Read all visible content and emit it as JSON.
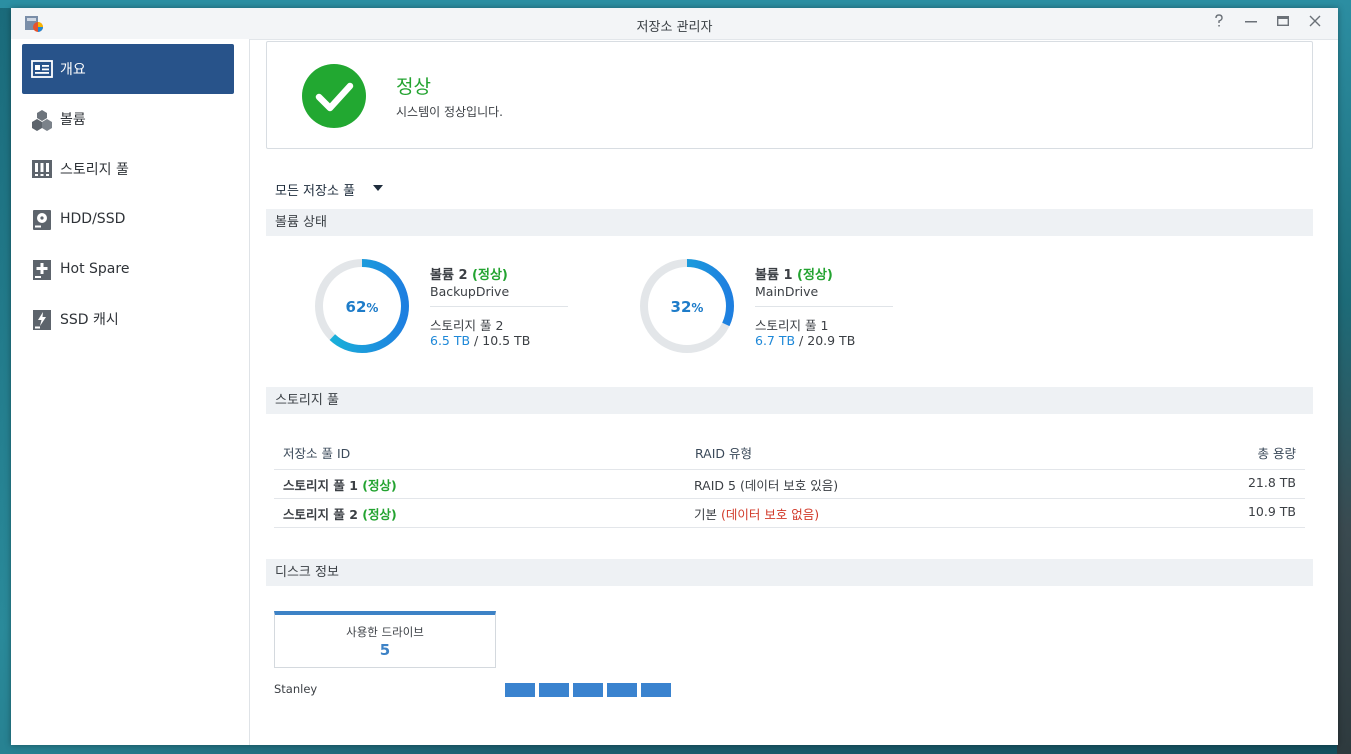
{
  "window": {
    "title": "저장소 관리자",
    "help_icon": "help-icon",
    "minimize_icon": "minimize-icon",
    "maximize_icon": "maximize-icon",
    "close_icon": "close-icon"
  },
  "sidebar": {
    "items": [
      {
        "label": "개요",
        "icon": "overview-icon",
        "active": true
      },
      {
        "label": "볼륨",
        "icon": "volume-cubes-icon",
        "active": false
      },
      {
        "label": "스토리지 풀",
        "icon": "storage-pool-icon",
        "active": false
      },
      {
        "label": "HDD/SSD",
        "icon": "disk-icon",
        "active": false
      },
      {
        "label": "Hot Spare",
        "icon": "hot-spare-plus-icon",
        "active": false
      },
      {
        "label": "SSD 캐시",
        "icon": "ssd-cache-bolt-icon",
        "active": false
      }
    ]
  },
  "status": {
    "title": "정상",
    "subtitle": "시스템이 정상입니다.",
    "color": "#22a831"
  },
  "pool_filter": {
    "label": "모든 저장소 풀"
  },
  "volume_section": {
    "title": "볼륨 상태"
  },
  "volumes": [
    {
      "percent": 62,
      "percent_label": "62",
      "pct_sign": "%",
      "name": "볼륨 2 ",
      "state": "정상",
      "desc": "BackupDrive",
      "pool": "스토리지 풀 2",
      "used": "6.5 TB",
      "sep": " / ",
      "total": "10.5 TB"
    },
    {
      "percent": 32,
      "percent_label": "32",
      "pct_sign": "%",
      "name": "볼륨 1 ",
      "state": "정상",
      "desc": "MainDrive",
      "pool": "스토리지 풀 1",
      "used": "6.7 TB",
      "sep": " / ",
      "total": "20.9 TB"
    }
  ],
  "pool_section": {
    "title": "스토리지 풀"
  },
  "pool_table": {
    "headers": [
      "저장소 풀 ID",
      "RAID 유형",
      "총 용량"
    ],
    "rows": [
      {
        "id": "스토리지 풀 1 ",
        "state": "정상",
        "raid": "RAID 5 (데이터 보호 있음)",
        "raid_type": "",
        "raid_note": "",
        "capacity": "21.8 TB"
      },
      {
        "id": "스토리지 풀 2 ",
        "state": "정상",
        "raid": "",
        "raid_type": "기본 ",
        "raid_note": "(데이터 보호 없음)",
        "capacity": "10.9 TB"
      }
    ]
  },
  "disk_section": {
    "title": "디스크 정보"
  },
  "drives": {
    "label": "사용한 드라이브",
    "count": "5",
    "host": "Stanley",
    "slots": 5
  },
  "colors": {
    "accent": "#28538a",
    "ok": "#23a330",
    "used": "#1e88d8",
    "warn": "#d23a2a",
    "donut_track": "#e3e6e9"
  }
}
